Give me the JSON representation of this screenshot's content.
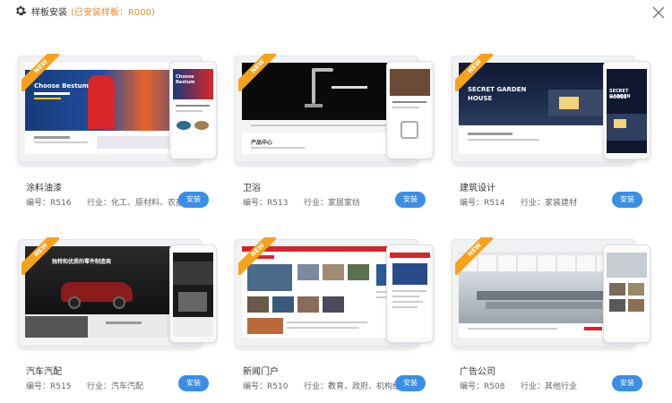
{
  "header": {
    "title": "样板安装",
    "subtitle": "(已安装样板：R000)",
    "icon": "gear-icon",
    "close_icon": "close-icon"
  },
  "ribbon_label": "NEW",
  "install_label": "安装",
  "accent_color": "#3a8ee6",
  "ribbon_color": "#f7a21b",
  "templates": [
    {
      "name": "涂料油漆",
      "code": "编号：R516",
      "industry": "行业：化工、原材料、农畜牧",
      "screen_text_1": "Choose Bestum",
      "screen_text_2": "Choose Bestum"
    },
    {
      "name": "卫浴",
      "code": "编号：R513",
      "industry": "行业：家居家纺",
      "screen_text_1": "产品中心"
    },
    {
      "name": "建筑设计",
      "code": "编号：R514",
      "industry": "行业：家装建材",
      "screen_text_1": "SECRET GARDEN",
      "screen_text_2": "HOUSE",
      "screen_text_3": "SECRET GARDEN",
      "screen_text_4": "HOUSE"
    },
    {
      "name": "汽车汽配",
      "code": "编号：R515",
      "industry": "行业：汽车汽配",
      "screen_text_1": "独特和优质的零件制造商"
    },
    {
      "name": "新闻门户",
      "code": "编号：R510",
      "industry": "行业：教育、政府、机构组织"
    },
    {
      "name": "广告公司",
      "code": "编号：R508",
      "industry": "行业：其他行业"
    }
  ]
}
